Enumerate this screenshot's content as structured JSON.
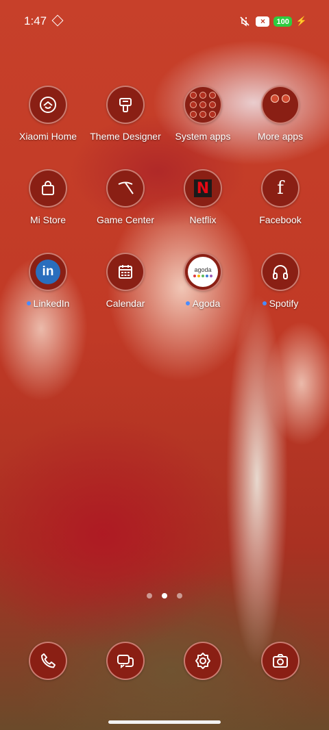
{
  "status_bar": {
    "time": "1:47",
    "battery_level": "100",
    "notification_badge": "×"
  },
  "apps": [
    {
      "label": "Xiaomi Home",
      "icon": "xiaomi-home-icon"
    },
    {
      "label": "Theme Designer",
      "icon": "paint-brush-icon"
    },
    {
      "label": "System apps",
      "icon": "folder-icon"
    },
    {
      "label": "More apps",
      "icon": "folder-icon"
    },
    {
      "label": "Mi Store",
      "icon": "shopping-bag-icon"
    },
    {
      "label": "Game Center",
      "icon": "game-center-icon"
    },
    {
      "label": "Netflix",
      "icon": "netflix-icon"
    },
    {
      "label": "Facebook",
      "icon": "facebook-icon"
    },
    {
      "label": "LinkedIn",
      "icon": "linkedin-icon",
      "has_new_dot": true
    },
    {
      "label": "Calendar",
      "icon": "calendar-icon"
    },
    {
      "label": "Agoda",
      "icon": "agoda-icon",
      "has_new_dot": true
    },
    {
      "label": "Spotify",
      "icon": "headphones-icon",
      "has_new_dot": true
    }
  ],
  "linkedin_logo": "in",
  "netflix_logo": "N",
  "facebook_logo": "f",
  "agoda_logo": "agoda",
  "dock": [
    {
      "icon": "phone-icon"
    },
    {
      "icon": "messages-icon"
    },
    {
      "icon": "settings-gear-icon"
    },
    {
      "icon": "camera-icon"
    }
  ],
  "pager": {
    "pages": 3,
    "current": 2
  },
  "colors": {
    "icon_background": "#8a1f14",
    "new_dot": "#4a8cff",
    "battery": "#2ecc40",
    "wallpaper_red": "#c23a24"
  }
}
